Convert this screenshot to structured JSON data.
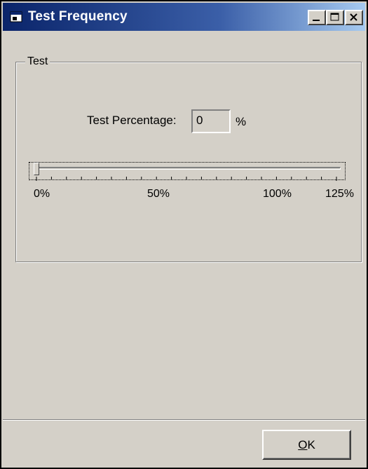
{
  "window": {
    "title": "Test Frequency"
  },
  "title_buttons": {
    "minimize": "minimize",
    "maximize": "maximize",
    "close": "close"
  },
  "group": {
    "label": "Test"
  },
  "percentage": {
    "label": "Test Percentage:",
    "value": "0",
    "unit": "%"
  },
  "slider": {
    "min": 0,
    "max": 125,
    "value": 0,
    "tick_labels": [
      "0%",
      "50%",
      "100%",
      "125%"
    ]
  },
  "footer": {
    "ok_label": "OK",
    "ok_mnemonic": "O"
  },
  "colors": {
    "face": "#d4d0c8",
    "title_start": "#0a246a",
    "title_end": "#a6caf0"
  }
}
